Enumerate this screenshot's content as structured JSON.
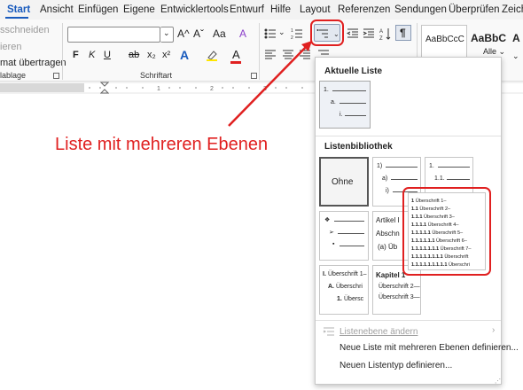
{
  "tabs": [
    "Start",
    "Ansicht",
    "Einfügen",
    "Eigene",
    "Entwicklertools",
    "Entwurf",
    "Hilfe",
    "Layout",
    "Referenzen",
    "Sendungen",
    "Überprüfen",
    "Zeich"
  ],
  "clipboard": {
    "cut": "sschneiden",
    "copy": "ieren",
    "painter": "mat übertragen",
    "label": "lablage"
  },
  "font": {
    "label": "Schriftart",
    "bold": "F",
    "italic": "K",
    "underline": "U",
    "strike": "ab",
    "sub": "x₂",
    "sup": "x²",
    "grow": "A^",
    "shrink": "Aˇ",
    "case": "Aa",
    "clear": "A"
  },
  "styles": {
    "s1": "AaBbCcC",
    "s2": "AaBbC",
    "s3": "A",
    "more": "Alle"
  },
  "callout": "Liste mit mehreren Ebenen",
  "gallery": {
    "current_heading": "Aktuelle Liste",
    "library_heading": "Listenbibliothek",
    "current": {
      "l1": "1.",
      "l2": "a.",
      "l3": "i."
    },
    "none": "Ohne",
    "t2": {
      "l1": "1)",
      "l2": "a)",
      "l3": "i)"
    },
    "t3": {
      "l1": "1.",
      "l2": "1.1."
    },
    "t5": {
      "l1": "Artikel I",
      "l2": "Abschn",
      "l3": "(a) Üb"
    },
    "t6": {
      "l1": "I.",
      "l1t": "Überschrift 1–",
      "l2": "A.",
      "l2t": "Überschri",
      "l3": "1.",
      "l3t": "Übersc"
    },
    "t7": {
      "l1": "Kapitel 1",
      "l2t": "Überschrift 2—",
      "l3t": "Überschrift 3—"
    },
    "headings": [
      {
        "num": "1",
        "text": "Überschrift 1–"
      },
      {
        "num": "1.1",
        "text": "Überschrift 2–"
      },
      {
        "num": "1.1.1",
        "text": "Überschrift 3–"
      },
      {
        "num": "1.1.1.1",
        "text": "Überschrift 4–"
      },
      {
        "num": "1.1.1.1.1",
        "text": "Überschrift 5–"
      },
      {
        "num": "1.1.1.1.1.1",
        "text": "Überschrift 6–"
      },
      {
        "num": "1.1.1.1.1.1.1",
        "text": "Überschrift 7–"
      },
      {
        "num": "1.1.1.1.1.1.1.1",
        "text": "Überschrift"
      },
      {
        "num": "1.1.1.1.1.1.1.1.1",
        "text": "Überschri"
      }
    ],
    "change_level": "Listenebene ändern",
    "define_multi": "Neue Liste mit mehreren Ebenen definieren...",
    "define_type": "Neuen Listentyp definieren..."
  },
  "colors": {
    "accent": "#185abd",
    "red": "#e02020"
  }
}
